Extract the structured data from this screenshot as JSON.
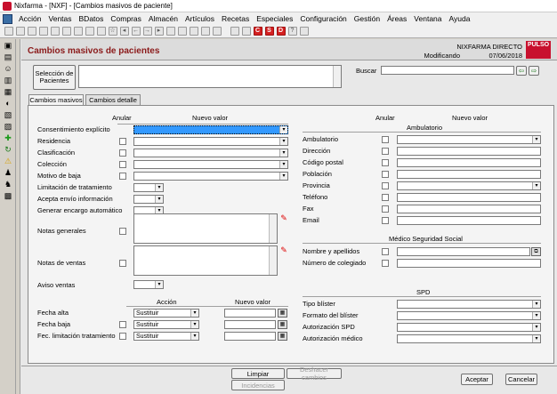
{
  "window": {
    "title": "Nixfarma - [NXF] - [Cambios masivos de paciente]"
  },
  "menu": [
    "Acción",
    "Ventas",
    "BDatos",
    "Compras",
    "Almacén",
    "Artículos",
    "Recetas",
    "Especiales",
    "Configuración",
    "Gestión",
    "Áreas",
    "Ventana",
    "Ayuda"
  ],
  "toolbar_badges": {
    "c": "C",
    "s": "S",
    "d": "D"
  },
  "header": {
    "title": "Cambios masivos de pacientes",
    "app": "NIXFARMA DIRECTO",
    "mode": "Modificando",
    "date": "07/06/2018",
    "logo": "PULSO"
  },
  "seleccion_button": "Selección de Pacientes",
  "buscar_label": "Buscar",
  "tabs": [
    "Cambios masivos",
    "Cambios detalle"
  ],
  "left": {
    "col_anular": "Anular",
    "col_nuevo": "Nuevo valor",
    "fields": {
      "consentimiento": "Consentimiento explícito",
      "residencia": "Residencia",
      "clasificacion": "Clasificación",
      "coleccion": "Colección",
      "motivo_baja": "Motivo de baja",
      "limitacion": "Limitación de tratamiento",
      "acepta_envio": "Acepta envío información",
      "generar_encargo": "Generar encargo automático",
      "notas_generales": "Notas generales",
      "notas_ventas": "Notas de ventas",
      "aviso_ventas": "Aviso ventas"
    },
    "fechas": {
      "col_accion": "Acción",
      "col_nuevo": "Nuevo valor",
      "rows": [
        {
          "label": "Fecha alta",
          "accion": "Sustituir"
        },
        {
          "label": "Fecha baja",
          "accion": "Sustituir"
        },
        {
          "label": "Fec. limitación tratamiento",
          "accion": "Sustituir"
        }
      ]
    }
  },
  "right": {
    "col_anular": "Anular",
    "col_nuevo": "Nuevo valor",
    "ambulatorio_title": "Ambulatorio",
    "ambulatorio_fields": [
      "Ambulatorio",
      "Dirección",
      "Código postal",
      "Población",
      "Provincia",
      "Teléfono",
      "Fax",
      "Email"
    ],
    "medico_title": "Médico Seguridad Social",
    "medico_fields": [
      "Nombre y apellidos",
      "Número de colegiado"
    ],
    "spd_title": "SPD",
    "spd_fields": [
      "Tipo blíster",
      "Formato del blíster",
      "Autorización SPD",
      "Autorización médico"
    ]
  },
  "buttons": {
    "limpiar": "Limpiar",
    "deshacer": "Deshacer cambios",
    "incidencias": "Incidencias",
    "aceptar": "Aceptar",
    "cancelar": "Cancelar"
  }
}
